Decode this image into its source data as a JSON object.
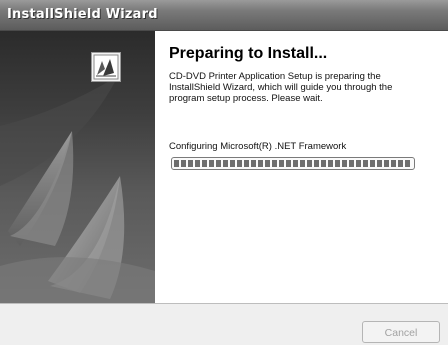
{
  "window": {
    "title": "InstallShield Wizard"
  },
  "content": {
    "heading": "Preparing to Install...",
    "description": "CD-DVD Printer Application Setup is preparing the InstallShield Wizard, which will guide you through the program setup process.  Please wait.",
    "status": "Configuring Microsoft(R) .NET Framework",
    "progress": 1.0
  },
  "footer": {
    "cancel_label": "Cancel",
    "cancel_enabled": false
  },
  "icons": {
    "logo": "installshield-logo-icon"
  },
  "colors": {
    "titlebar": "#6a6a6a",
    "left_panel_dark": "#2b2b2b",
    "progress_fill": "#6e6e6e"
  }
}
